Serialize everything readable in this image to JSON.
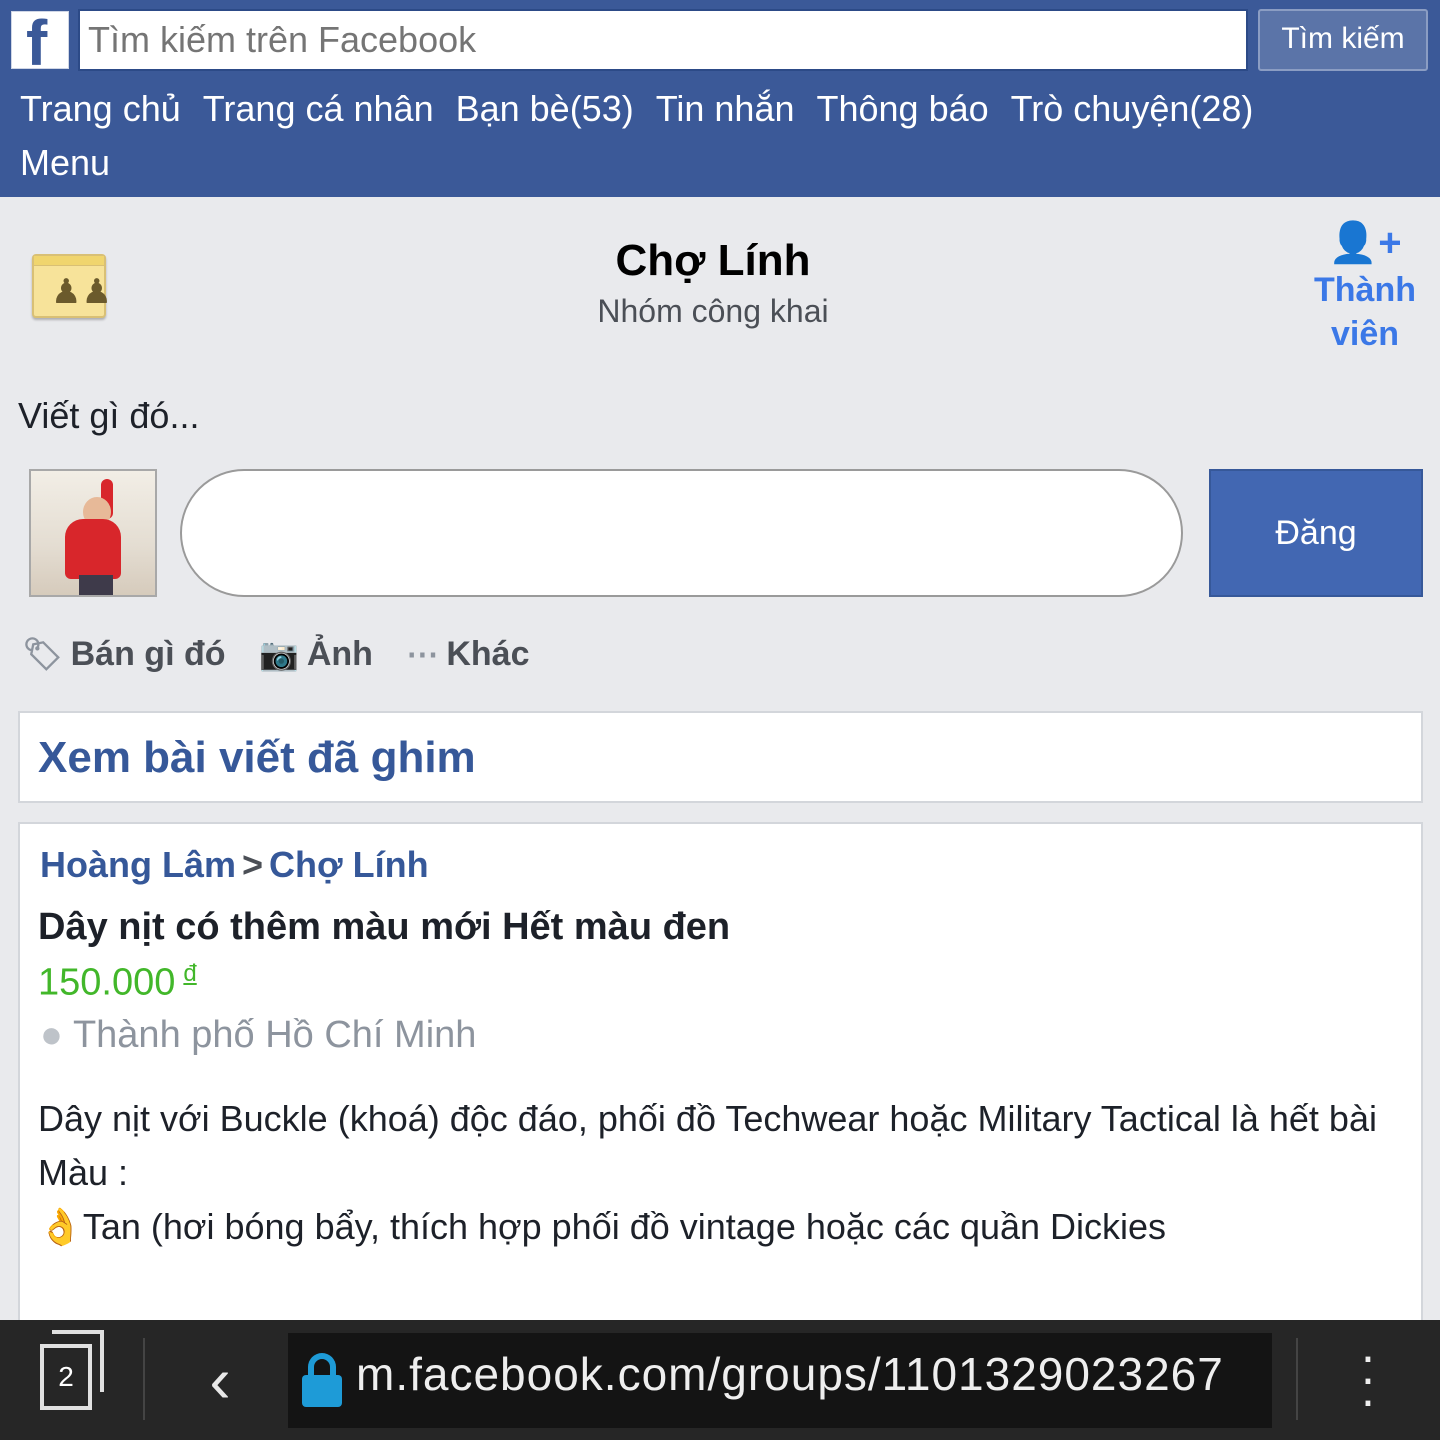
{
  "header": {
    "logo_letter": "f",
    "search_placeholder": "Tìm kiếm trên Facebook",
    "search_button": "Tìm kiếm",
    "nav": [
      "Trang chủ",
      "Trang cá nhân",
      "Bạn bè(53)",
      "Tin nhắn",
      "Thông báo",
      "Trò chuyện(28)",
      "Menu"
    ]
  },
  "group": {
    "name": "Chợ Lính",
    "type": "Nhóm công khai",
    "member_button": "Thành viên"
  },
  "composer": {
    "prompt": "Viết gì đó...",
    "post_button": "Đăng",
    "actions": [
      {
        "icon": "tag-icon",
        "label": "Bán gì đó"
      },
      {
        "icon": "camera-icon",
        "label": "Ảnh"
      },
      {
        "icon": "more-icon",
        "label": "Khác"
      }
    ]
  },
  "pinned": {
    "label": "Xem bài viết đã ghim"
  },
  "post": {
    "author": "Hoàng Lâm",
    "separator": ">",
    "group": "Chợ Lính",
    "title": "Dây nịt có thêm màu mới Hết màu đen",
    "price": "150.000",
    "currency": "đ",
    "location": "Thành phố Hồ Chí Minh",
    "body_line1": "Dây nịt với Buckle (khoá) độc đáo, phối đồ Techwear hoặc Military Tactical là hết bài",
    "body_line2": "Màu :",
    "body_line3": "Tan (hơi bóng bẩy, thích hợp phối đồ vintage hoặc các quần Dickies",
    "body_line3_emoji": "👌"
  },
  "browser": {
    "tab_count": "2",
    "url": "m.facebook.com/groups/1101329023267"
  },
  "colors": {
    "brand": "#3b5998",
    "link": "#365899",
    "price": "#42b72a",
    "accent_blue": "#3b78e7",
    "lock": "#1e9bd7"
  }
}
